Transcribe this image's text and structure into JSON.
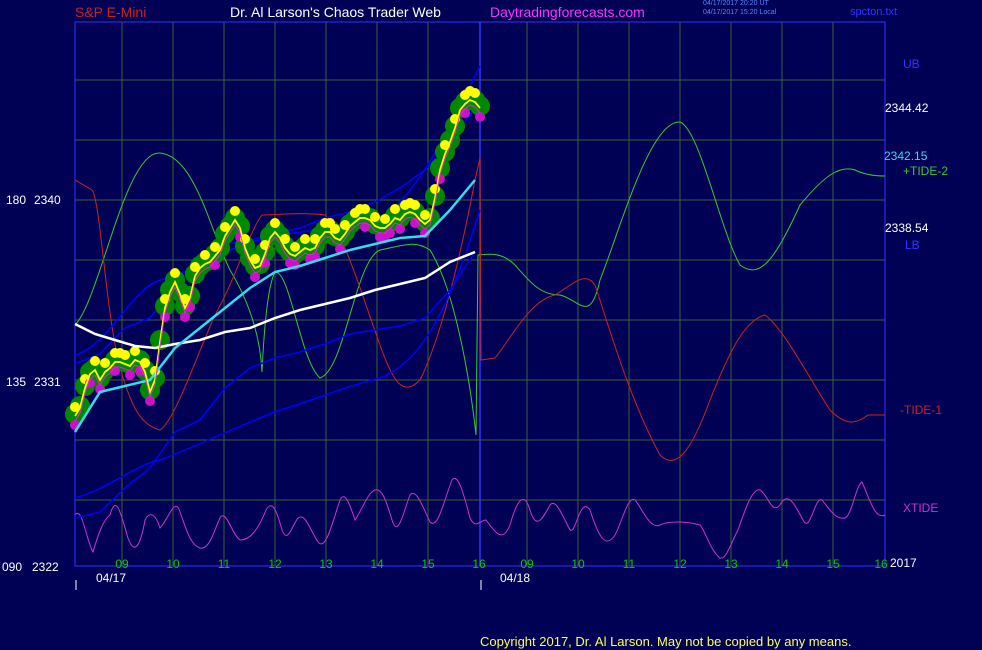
{
  "header": {
    "instrument": "S&P E-Mini",
    "site": "Dr. Al Larson's Chaos Trader Web",
    "url": "Daytradingforecasts.com",
    "stamp_ut": "04/17/2017 20:20 UT",
    "stamp_local": "04/17/2017 15:20 Local",
    "filename": "spcton.txt"
  },
  "footer": {
    "copyright": "Copyright 2017, Dr. Al Larson. May not be copied by any means."
  },
  "colors": {
    "background": "#000055",
    "frame": "#3333ff",
    "grid": "#3b5e3b",
    "price": "#ffff00",
    "cyan_ma": "#33ddee",
    "white_ma": "#ffffff",
    "band": "#0000ff",
    "tide_plus": "#33cc33",
    "tide_minus": "#cc2222",
    "xtide": "#cc33cc",
    "dot_high": "#ffff00",
    "dot_low": "#cc11cc",
    "glow": "#008800"
  },
  "chart_data": {
    "type": "line",
    "title": "S&P E-Mini",
    "x_hour_ticks": [
      "09",
      "10",
      "11",
      "12",
      "13",
      "14",
      "15",
      "16",
      "09",
      "10",
      "11",
      "12",
      "13",
      "14",
      "15",
      "16"
    ],
    "date_labels": [
      "04/17",
      "04/18"
    ],
    "year_label": "2017",
    "y_left_labels": [
      {
        "row": "180",
        "price": "2340"
      },
      {
        "row": "135",
        "price": "2331"
      },
      {
        "row": "090",
        "price": "2322"
      }
    ],
    "y_price_range": [
      2322,
      2340
    ],
    "right_labels": {
      "ub": "UB",
      "ub_value": "2344.42",
      "cyan_value": "2342.15",
      "tide2": "+TIDE-2",
      "lb_value": "2338.54",
      "lb": "LB",
      "tide1": "-TIDE-1",
      "xtide": "XTIDE"
    },
    "series": [
      {
        "name": "price",
        "x": [
          0,
          1,
          2,
          3,
          4,
          5,
          6,
          7,
          8,
          9,
          10,
          11,
          12,
          13,
          14,
          15,
          16,
          17,
          18,
          19,
          20,
          21,
          22,
          23,
          24,
          25,
          26,
          27,
          28,
          29,
          30,
          31,
          32,
          33,
          34,
          35,
          36,
          37,
          38,
          39,
          40,
          41,
          42,
          43,
          44,
          45,
          46,
          47,
          48,
          49,
          50,
          51,
          52,
          53,
          54,
          55,
          56,
          57,
          58,
          59,
          60,
          61,
          62,
          63,
          64,
          65,
          66,
          67,
          68,
          69,
          70,
          71,
          72,
          73,
          74,
          75,
          76,
          77,
          78,
          79,
          80,
          81
        ],
        "y": [
          2329.2,
          2329.6,
          2330.6,
          2331.3,
          2331.5,
          2331.0,
          2331.4,
          2331.6,
          2331.9,
          2331.9,
          2331.8,
          2331.7,
          2332.0,
          2331.9,
          2331.4,
          2330.4,
          2331.0,
          2332.9,
          2334.6,
          2335.4,
          2335.9,
          2335.3,
          2334.6,
          2335.1,
          2336.2,
          2336.6,
          2336.8,
          2336.9,
          2337.2,
          2337.5,
          2338.2,
          2338.6,
          2339.0,
          2338.6,
          2337.6,
          2337.0,
          2336.6,
          2336.7,
          2337.3,
          2338.1,
          2338.4,
          2338.1,
          2337.6,
          2337.3,
          2337.2,
          2337.4,
          2337.6,
          2337.5,
          2337.6,
          2338.1,
          2338.4,
          2338.4,
          2338.1,
          2338.0,
          2338.3,
          2338.7,
          2338.9,
          2339.1,
          2339.1,
          2339.0,
          2338.7,
          2338.6,
          2338.6,
          2338.8,
          2339.1,
          2339.0,
          2339.3,
          2339.4,
          2339.3,
          2339.0,
          2338.8,
          2339.0,
          2340.1,
          2341.5,
          2342.3,
          2342.9,
          2343.6,
          2344.5,
          2344.8,
          2345.0,
          2344.9,
          2344.6
        ]
      },
      {
        "name": "cyan",
        "x": [
          0,
          5,
          10,
          15,
          20,
          25,
          30,
          35,
          40,
          45,
          50,
          55,
          60,
          65,
          70,
          75,
          80
        ],
        "y": [
          2328.4,
          2330.4,
          2330.7,
          2331.0,
          2332.6,
          2333.6,
          2334.6,
          2335.6,
          2336.4,
          2336.7,
          2337.1,
          2337.5,
          2337.8,
          2338.1,
          2338.2,
          2339.5,
          2341.0
        ]
      },
      {
        "name": "white",
        "x": [
          0,
          4,
          8,
          12,
          16,
          20,
          25,
          30,
          35,
          40,
          45,
          50,
          55,
          60,
          65,
          70,
          75,
          80
        ],
        "y": [
          2333.8,
          2333.3,
          2333.0,
          2332.7,
          2332.6,
          2332.8,
          2333.0,
          2333.4,
          2333.6,
          2334.1,
          2334.5,
          2334.8,
          2335.1,
          2335.5,
          2335.8,
          2336.1,
          2336.9,
          2337.4
        ]
      },
      {
        "name": "UB",
        "x": [
          0,
          5,
          10,
          15,
          20,
          25,
          30,
          35,
          40,
          45,
          50,
          55,
          60,
          65,
          70,
          75,
          80
        ],
        "y": [
          2331.8,
          2332.3,
          2333.6,
          2334.1,
          2335.6,
          2337.1,
          2337.8,
          2338.0,
          2338.3,
          2338.6,
          2339.1,
          2339.4,
          2339.9,
          2340.6,
          2341.5,
          2342.9,
          2344.6
        ]
      },
      {
        "name": "LB",
        "x": [
          0,
          5,
          10,
          15,
          20,
          25,
          30,
          35,
          40,
          45,
          50,
          55,
          60,
          65,
          70,
          75,
          80
        ],
        "y": [
          2324.1,
          2324.4,
          2325.6,
          2326.6,
          2328.4,
          2329.0,
          2330.6,
          2331.6,
          2332.1,
          2332.4,
          2332.8,
          2333.3,
          2333.5,
          2333.7,
          2334.1,
          2335.5,
          2337.4
        ]
      }
    ]
  }
}
